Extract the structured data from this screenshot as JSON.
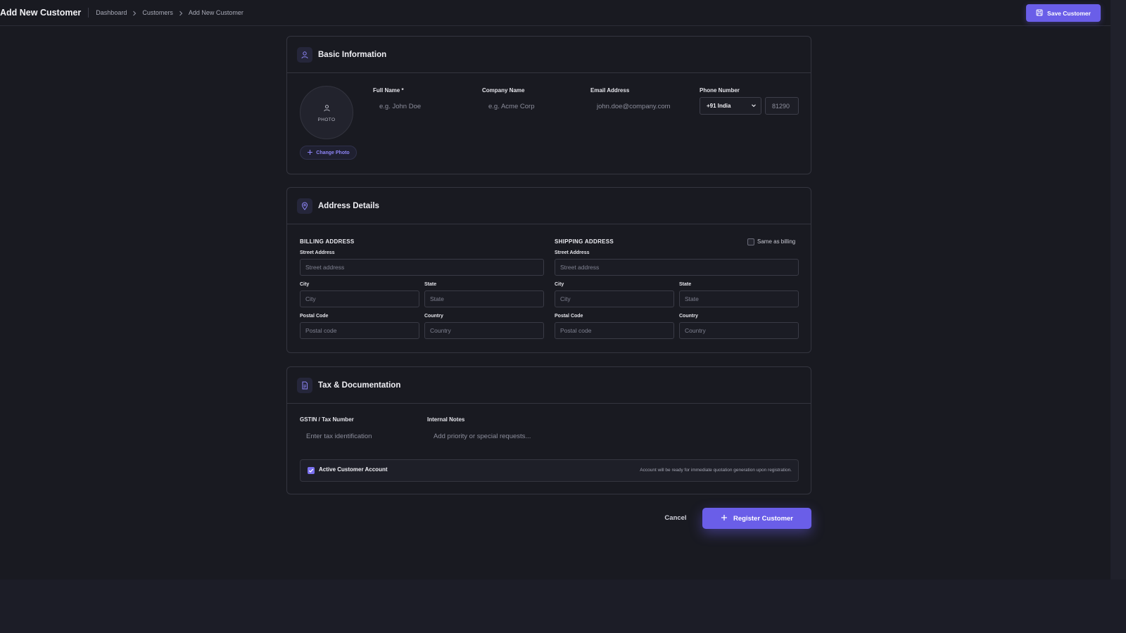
{
  "header": {
    "title": "Add New Customer",
    "breadcrumb": [
      "Dashboard",
      "Customers",
      "Add New Customer"
    ],
    "save_label": "Save Customer"
  },
  "basic": {
    "title": "Basic Information",
    "photo_label": "PHOTO",
    "change_photo": "Change Photo",
    "full_name_label": "Full Name *",
    "full_name_placeholder": "e.g. John Doe",
    "company_label": "Company Name",
    "company_placeholder": "e.g. Acme Corp",
    "email_label": "Email Address",
    "email_placeholder": "john.doe@company.com",
    "phone_label": "Phone Number",
    "phone_code": "+91 India",
    "phone_placeholder": "81290"
  },
  "address": {
    "title": "Address Details",
    "billing": {
      "heading": "BILLING ADDRESS",
      "street_label": "Street Address",
      "street_placeholder": "Street address",
      "city_label": "City",
      "city_placeholder": "City",
      "state_label": "State",
      "state_placeholder": "State",
      "postal_label": "Postal Code",
      "postal_placeholder": "Postal code",
      "country_label": "Country",
      "country_placeholder": "Country"
    },
    "shipping": {
      "heading": "SHIPPING ADDRESS",
      "same_as_billing": "Same as billing",
      "street_label": "Street Address",
      "street_placeholder": "Street address",
      "city_label": "City",
      "city_placeholder": "City",
      "state_label": "State",
      "state_placeholder": "State",
      "postal_label": "Postal Code",
      "postal_placeholder": "Postal code",
      "country_label": "Country",
      "country_placeholder": "Country"
    }
  },
  "tax": {
    "title": "Tax & Documentation",
    "gstin_label": "GSTIN / Tax Number",
    "gstin_placeholder": "Enter tax identification",
    "notes_label": "Internal Notes",
    "notes_placeholder": "Add priority or special requests...",
    "active_label": "Active Customer Account",
    "active_note": "Account will be ready for immediate quotation generation upon registration."
  },
  "actions": {
    "cancel": "Cancel",
    "register": "Register Customer"
  },
  "colors": {
    "accent": "#6a5ee8",
    "background": "#191a21",
    "card_border": "#34353f"
  }
}
